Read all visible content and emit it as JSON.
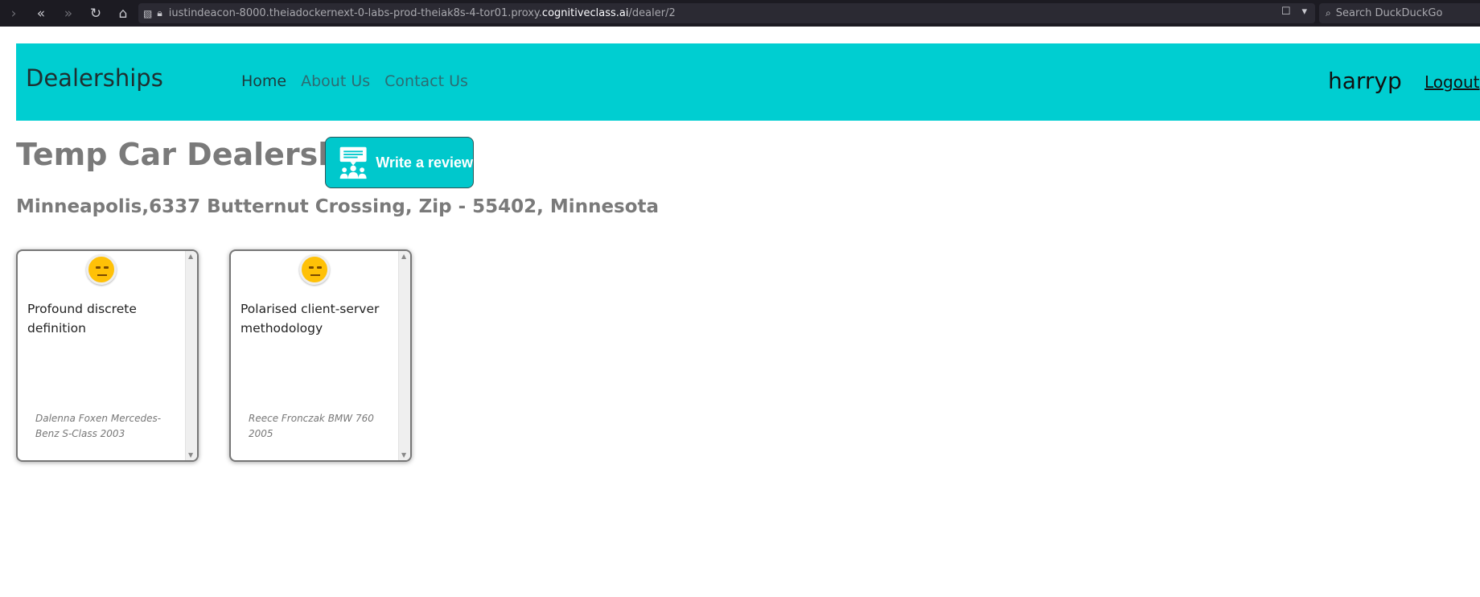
{
  "browser": {
    "url_prefix": "iustindeacon-8000.theiadockernext-0-labs-prod-theiak8s-4-tor01.proxy.",
    "url_domain": "cognitiveclass.ai",
    "url_path": "/dealer/2",
    "search_placeholder": "Search DuckDuckGo"
  },
  "navbar": {
    "brand": "Dealerships",
    "links": [
      {
        "label": "Home"
      },
      {
        "label": "About Us"
      },
      {
        "label": "Contact Us"
      }
    ],
    "username": "harryp",
    "logout_label": "Logout",
    "color": "#00ced1"
  },
  "dealer": {
    "name": "Temp Car Dealership",
    "write_review_label": "Write a review",
    "address": "Minneapolis,6337 Butternut Crossing, Zip - 55402, Minnesota"
  },
  "reviews": [
    {
      "sentiment_icon": "neutral-face-icon",
      "text": "Profound discrete definition",
      "reviewer": "Dalenna Foxen Mercedes-Benz S-Class 2003"
    },
    {
      "sentiment_icon": "neutral-face-icon",
      "text": "Polarised client-server methodology",
      "reviewer": "Reece Fronczak BMW 760 2005"
    }
  ]
}
